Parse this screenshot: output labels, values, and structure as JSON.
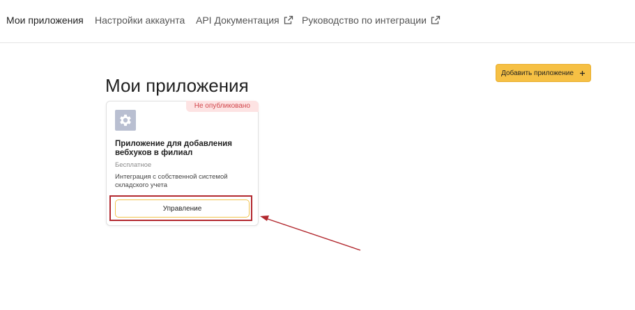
{
  "nav": {
    "items": [
      {
        "label": "Мои приложения",
        "external": false,
        "active": true
      },
      {
        "label": "Настройки аккаунта",
        "external": false,
        "active": false
      },
      {
        "label": "API Документация",
        "external": true,
        "active": false
      },
      {
        "label": "Руководство по интеграции",
        "external": true,
        "active": false
      }
    ]
  },
  "page": {
    "title": "Мои приложения",
    "add_button_label": "Добавить приложение",
    "add_button_icon": "plus"
  },
  "app_card": {
    "badge": "Не опубликовано",
    "icon": "gear-icon",
    "name": "Приложение для добавления вебхуков в филиал",
    "price": "Бесплатное",
    "description": "Интеграция с собственной системой складского учета",
    "manage_button_label": "Управление"
  },
  "colors": {
    "accent": "#f6c044",
    "badge_bg": "#fde3e3",
    "badge_text": "#d1454a",
    "annotation": "#b2282e"
  }
}
